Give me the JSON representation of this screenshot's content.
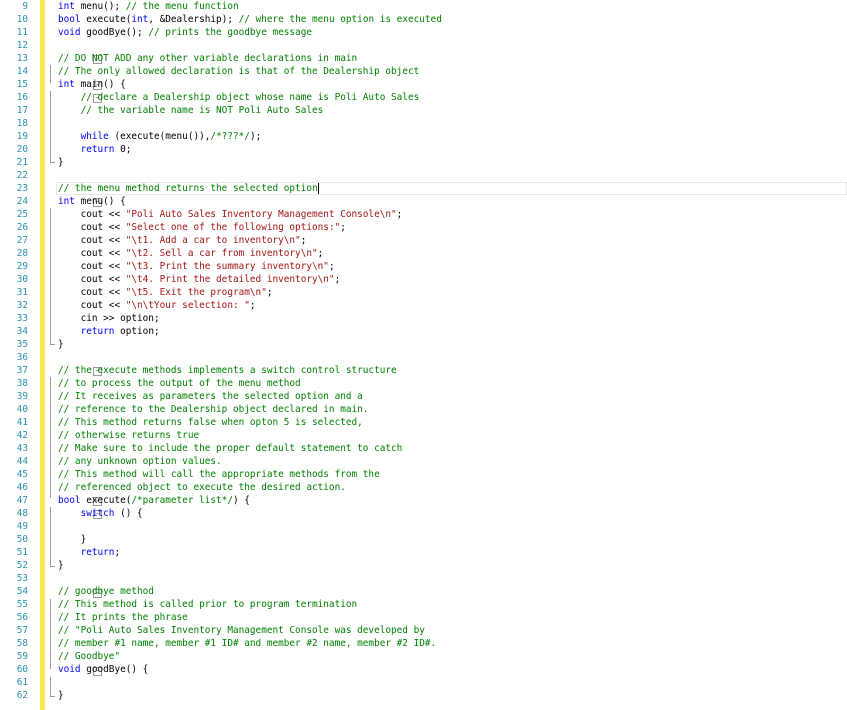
{
  "editor": {
    "lines": [
      {
        "n": "9",
        "t": "int menu(); // the menu function"
      },
      {
        "n": "10",
        "t": "bool execute(int, &Dealership); // where the menu option is executed"
      },
      {
        "n": "11",
        "t": "void goodBye(); // prints the goodbye message"
      },
      {
        "n": "12",
        "t": ""
      },
      {
        "n": "13",
        "t": "// DO NOT ADD any other variable declarations in main"
      },
      {
        "n": "14",
        "t": "// The only allowed declaration is that of the Dealership object"
      },
      {
        "n": "15",
        "t": "int main() {"
      },
      {
        "n": "16",
        "t": "    // declare a Dealership object whose name is Poli Auto Sales"
      },
      {
        "n": "17",
        "t": "    // the variable name is NOT Poli Auto Sales"
      },
      {
        "n": "18",
        "t": ""
      },
      {
        "n": "19",
        "t": "    while (execute(menu()),/*???*/);"
      },
      {
        "n": "20",
        "t": "    return 0;"
      },
      {
        "n": "21",
        "t": "}"
      },
      {
        "n": "22",
        "t": ""
      },
      {
        "n": "23",
        "t": "// the menu method returns the selected option"
      },
      {
        "n": "24",
        "t": "int menu() {"
      },
      {
        "n": "25",
        "t": "    cout << \"Poli Auto Sales Inventory Management Console\\n\";"
      },
      {
        "n": "26",
        "t": "    cout << \"Select one of the following options:\";"
      },
      {
        "n": "27",
        "t": "    cout << \"\\t1. Add a car to inventory\\n\";"
      },
      {
        "n": "28",
        "t": "    cout << \"\\t2. Sell a car from inventory\\n\";"
      },
      {
        "n": "29",
        "t": "    cout << \"\\t3. Print the summary inventory\\n\";"
      },
      {
        "n": "30",
        "t": "    cout << \"\\t4. Print the detailed inventory\\n\";"
      },
      {
        "n": "31",
        "t": "    cout << \"\\t5. Exit the program\\n\";"
      },
      {
        "n": "32",
        "t": "    cout << \"\\n\\tYour selection: \";"
      },
      {
        "n": "33",
        "t": "    cin >> option;"
      },
      {
        "n": "34",
        "t": "    return option;"
      },
      {
        "n": "35",
        "t": "}"
      },
      {
        "n": "36",
        "t": ""
      },
      {
        "n": "37",
        "t": "// the execute methods implements a switch control structure"
      },
      {
        "n": "38",
        "t": "// to process the output of the menu method"
      },
      {
        "n": "39",
        "t": "// It receives as parameters the selected option and a"
      },
      {
        "n": "40",
        "t": "// reference to the Dealership object declared in main."
      },
      {
        "n": "41",
        "t": "// This method returns false when opton 5 is selected,"
      },
      {
        "n": "42",
        "t": "// otherwise returns true"
      },
      {
        "n": "43",
        "t": "// Make sure to include the proper default statement to catch"
      },
      {
        "n": "44",
        "t": "// any unknown option values."
      },
      {
        "n": "45",
        "t": "// This method will call the appropriate methods from the"
      },
      {
        "n": "46",
        "t": "// referenced object to execute the desired action."
      },
      {
        "n": "47",
        "t": "bool execute(/*parameter list*/) {"
      },
      {
        "n": "48",
        "t": "    switch () {"
      },
      {
        "n": "49",
        "t": ""
      },
      {
        "n": "50",
        "t": "    }"
      },
      {
        "n": "51",
        "t": "    return;"
      },
      {
        "n": "52",
        "t": "}"
      },
      {
        "n": "53",
        "t": ""
      },
      {
        "n": "54",
        "t": "// goodbye method"
      },
      {
        "n": "55",
        "t": "// This method is called prior to program termination"
      },
      {
        "n": "56",
        "t": "// It prints the phrase"
      },
      {
        "n": "57",
        "t": "// \"Poli Auto Sales Inventory Management Console was developed by"
      },
      {
        "n": "58",
        "t": "// member #1 name, member #1 ID# and member #2 name, member #2 ID#."
      },
      {
        "n": "59",
        "t": "// Goodbye\""
      },
      {
        "n": "60",
        "t": "void goodBye() {"
      },
      {
        "n": "61",
        "t": ""
      },
      {
        "n": "62",
        "t": "}"
      }
    ]
  }
}
